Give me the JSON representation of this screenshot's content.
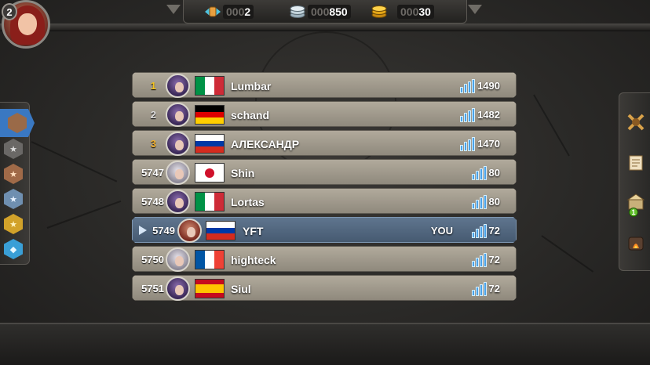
{
  "player": {
    "level": "2"
  },
  "resources": [
    {
      "name": "fist-token",
      "dim": "000",
      "bright": "2"
    },
    {
      "name": "silver-coins",
      "dim": "000",
      "bright": "850"
    },
    {
      "name": "gold-coins",
      "dim": "000",
      "bright": "30"
    }
  ],
  "leaderboard": {
    "you_label": "YOU",
    "rows": [
      {
        "rank": "1",
        "name": "Lumbar",
        "score": "1490",
        "flag": "it",
        "portrait": "purple",
        "rank_color": "gold"
      },
      {
        "rank": "2",
        "name": "schand",
        "score": "1482",
        "flag": "de",
        "portrait": "purple",
        "rank_color": "silver"
      },
      {
        "rank": "3",
        "name": "АЛЕКСАНДР",
        "score": "1470",
        "flag": "ru",
        "portrait": "purple",
        "rank_color": "bronze"
      },
      {
        "rank": "5747",
        "name": "Shin",
        "score": "80",
        "flag": "jp",
        "portrait": "white",
        "rank_color": "white"
      },
      {
        "rank": "5748",
        "name": "Lortas",
        "score": "80",
        "flag": "it",
        "portrait": "purple",
        "rank_color": "white"
      },
      {
        "rank": "5749",
        "name": "YFT",
        "score": "72",
        "flag": "ru",
        "portrait": "red",
        "rank_color": "white",
        "is_you": true
      },
      {
        "rank": "5750",
        "name": "highteck",
        "score": "72",
        "flag": "fr",
        "portrait": "white",
        "rank_color": "white"
      },
      {
        "rank": "5751",
        "name": "Siul",
        "score": "72",
        "flag": "es",
        "portrait": "purple",
        "rank_color": "white"
      }
    ]
  },
  "left_tabs": [
    {
      "name": "league-hex-bronze-tab",
      "active": true
    },
    {
      "name": "league-star-1-tab"
    },
    {
      "name": "league-star-2-tab"
    },
    {
      "name": "league-star-3-tab"
    },
    {
      "name": "league-star-gold-tab"
    },
    {
      "name": "league-diamond-tab"
    }
  ],
  "right_buttons": [
    {
      "name": "clan-icon"
    },
    {
      "name": "quests-scroll-icon"
    },
    {
      "name": "shop-icon",
      "badge": "1"
    },
    {
      "name": "furnace-icon"
    }
  ],
  "colors": {
    "row_bg": "#a49d90",
    "row_you_bg": "#526a84",
    "score_bars": "#4aa3e8",
    "rank_gold": "#f2c21f"
  }
}
